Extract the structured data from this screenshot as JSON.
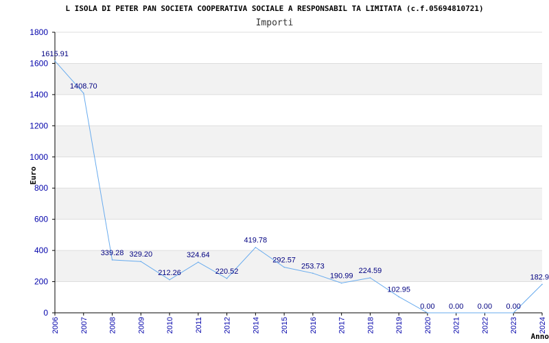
{
  "title": "L ISOLA DI PETER PAN SOCIETA COOPERATIVA SOCIALE A RESPONSABIL TA LIMITATA (c.f.05694810721)",
  "chart_data": {
    "type": "line",
    "title": "Importi",
    "xlabel": "Anno",
    "ylabel": "Euro",
    "ylim": [
      0,
      1800
    ],
    "yticks": [
      "0",
      "200",
      "400",
      "600",
      "800",
      "1000",
      "1200",
      "1400",
      "1600",
      "1800"
    ],
    "grid": true,
    "colors": {
      "line": "#66aaee",
      "band": "#f2f2f2",
      "grid": "#dddddd",
      "tick_text": "#0000aa",
      "label_text": "#000080"
    },
    "categories": [
      "2006",
      "2007",
      "2008",
      "2009",
      "2010",
      "2011",
      "2012",
      "2014",
      "2015",
      "2016",
      "2017",
      "2018",
      "2019",
      "2020",
      "2021",
      "2022",
      "2023",
      "2024"
    ],
    "values": [
      1615.91,
      1408.7,
      339.28,
      329.2,
      212.26,
      324.64,
      220.52,
      419.78,
      292.57,
      253.73,
      190.99,
      224.59,
      102.95,
      0.0,
      0.0,
      0.0,
      0.0,
      182.9
    ],
    "value_labels": [
      "1615.91",
      "1408.70",
      "339.28",
      "329.20",
      "212.26",
      "324.64",
      "220.52",
      "419.78",
      "292.57",
      "253.73",
      "190.99",
      "224.59",
      "102.95",
      "0.00",
      "0.00",
      "0.00",
      "0.00",
      "182.9"
    ]
  }
}
